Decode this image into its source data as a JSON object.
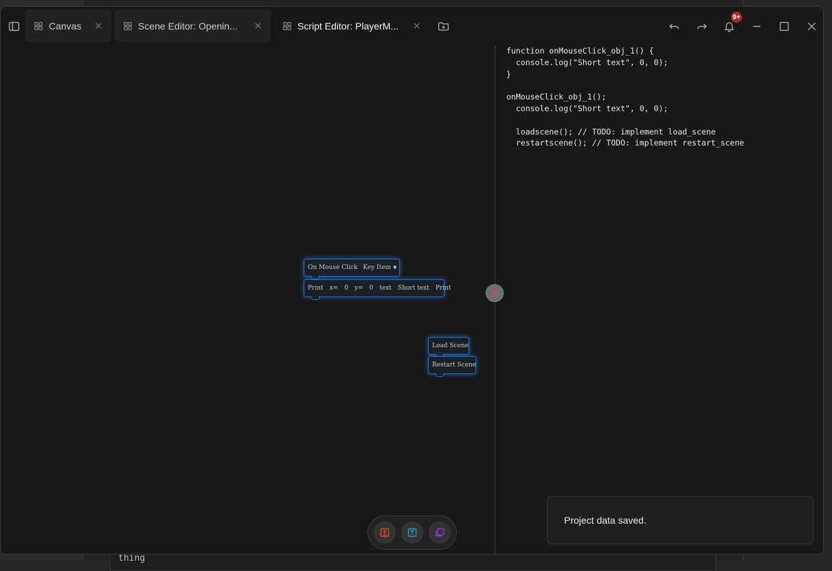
{
  "background": {
    "doc_text": "thing"
  },
  "tabs": [
    {
      "label": "Canvas",
      "state": "inactive"
    },
    {
      "label": "Scene Editor: Openin...",
      "state": "inactive"
    },
    {
      "label": "Script Editor: PlayerM...",
      "state": "active"
    }
  ],
  "notifications": {
    "badge": "9+"
  },
  "code": {
    "lines": [
      "function onMouseClick_obj_1() {",
      "  console.log(\"Short text\", 0, 0);",
      "}",
      "",
      "onMouseClick_obj_1();",
      "  console.log(\"Short text\", 0, 0);",
      "",
      "  loadscene(); // TODO: implement load_scene",
      "  restartscene(); // TODO: implement restart_scene"
    ]
  },
  "blocks": {
    "event": {
      "label": "On Mouse Click",
      "target": "Key Item"
    },
    "print": {
      "label": "Print",
      "x_label": "x=",
      "x": "0",
      "y_label": "y=",
      "y": "0",
      "text_label": "text",
      "text": "Short text",
      "end_label": "Print"
    },
    "load_scene": {
      "label": "Load Scene"
    },
    "restart_scene": {
      "label": "Restart Scene"
    }
  },
  "toast": {
    "message": "Project data saved."
  },
  "colors": {
    "block_border": "#1f6fd1",
    "tool_export": "#d9452b",
    "tool_text": "#1fa3c4",
    "tool_layers": "#9b2fd6",
    "badge": "#b3261e"
  }
}
